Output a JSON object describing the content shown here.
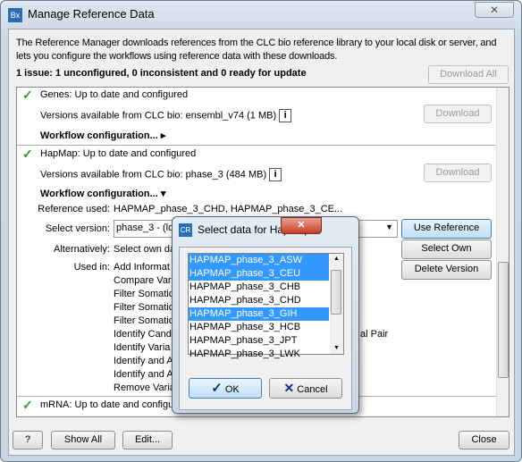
{
  "window": {
    "title": "Manage Reference Data",
    "app_icon": "Bx"
  },
  "intro": "The Reference Manager downloads references from the CLC bio reference library to your local disk or server, and",
  "intro2": "lets you configure the workflows using reference data with these downloads.",
  "issues": "1 issue: 1 unconfigured, 0 inconsistent and 0 ready for update",
  "download_all": "Download All",
  "genes": {
    "status": "Genes: Up to date and configured",
    "versions_label": "Versions available from CLC bio:",
    "versions_value": "ensembl_v74 (1 MB)",
    "download": "Download",
    "workflow": "Workflow configuration..."
  },
  "hapmap": {
    "status": "HapMap: Up to date and configured",
    "versions_label": "Versions available from CLC bio:",
    "versions_value": "phase_3 (484 MB)",
    "download": "Download",
    "workflow": "Workflow configuration...",
    "reference_used_label": "Reference used:",
    "reference_used_value": "HAPMAP_phase_3_CHD, HAPMAP_phase_3_CE...",
    "select_version_label": "Select version:",
    "select_version_value": "phase_3 - (lo",
    "alternatively_label": "Alternatively:",
    "alternatively_value": "Select own da",
    "used_in_label": "Used in:",
    "used_in": [
      "Add Informat",
      "Compare Vari",
      "Filter Somatic",
      "Filter Somatic",
      "Filter Somatic",
      "Identify Cand",
      "Identify Varia",
      "Identify and A",
      "Identify and A",
      "Remove Varia"
    ],
    "used_in_fragment": "al Pair",
    "use_reference": "Use Reference",
    "select_own": "Select Own",
    "delete_version": "Delete Version"
  },
  "mrna": {
    "status": "mRNA: Up to date and configu"
  },
  "footer": {
    "help": "?",
    "show_all": "Show All",
    "edit": "Edit...",
    "close": "Close"
  },
  "dialog": {
    "title": "Select data for HapMap",
    "icon": "CR",
    "items": [
      {
        "label": "HAPMAP_phase_3_ASW",
        "selected": true
      },
      {
        "label": "HAPMAP_phase_3_CEU",
        "selected": true
      },
      {
        "label": "HAPMAP_phase_3_CHB",
        "selected": false
      },
      {
        "label": "HAPMAP_phase_3_CHD",
        "selected": false
      },
      {
        "label": "HAPMAP_phase_3_GIH",
        "selected": true
      },
      {
        "label": "HAPMAP_phase_3_HCB",
        "selected": false
      },
      {
        "label": "HAPMAP_phase_3_JPT",
        "selected": false
      },
      {
        "label": "HAPMAP_phase_3_LWK",
        "selected": false
      }
    ],
    "ok": "OK",
    "cancel": "Cancel"
  },
  "colors": {
    "selection": "#3399ff",
    "check": "#2f9a2f"
  }
}
